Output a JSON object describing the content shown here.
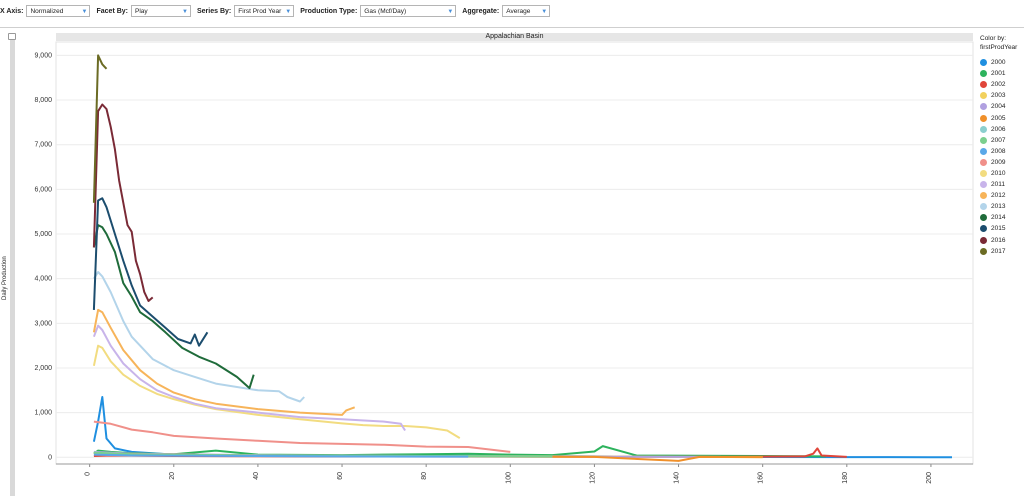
{
  "toolbar": {
    "x_axis": {
      "label": "X Axis:",
      "value": "Normalized"
    },
    "facet_by": {
      "label": "Facet By:",
      "value": "Play"
    },
    "series_by": {
      "label": "Series By:",
      "value": "First Prod Year"
    },
    "production_type": {
      "label": "Production Type:",
      "value": "Gas (Mcf/Day)"
    },
    "aggregate": {
      "label": "Aggregate:",
      "value": "Average"
    }
  },
  "legend": {
    "title": "Color by:",
    "field": "firstProdYear"
  },
  "chart_data": {
    "type": "line",
    "title": "Appalachian Basin",
    "xlabel": "",
    "ylabel": "Daily Production",
    "xlim": [
      -8,
      210
    ],
    "ylim": [
      -150,
      9300
    ],
    "x_ticks": [
      0,
      20,
      40,
      60,
      80,
      100,
      120,
      140,
      160,
      180,
      200
    ],
    "y_ticks": [
      0,
      1000,
      2000,
      3000,
      4000,
      5000,
      6000,
      7000,
      8000,
      9000
    ],
    "y_tick_labels": [
      "0",
      "1,000",
      "2,000",
      "3,000",
      "4,000",
      "5,000",
      "6,000",
      "7,000",
      "8,000",
      "9,000"
    ],
    "grid": "horizontal",
    "legend_position": "right",
    "series": [
      {
        "name": "2000",
        "color": "#1f8fe0",
        "points": [
          [
            1,
            350
          ],
          [
            2,
            800
          ],
          [
            3,
            1350
          ],
          [
            4,
            420
          ],
          [
            6,
            200
          ],
          [
            10,
            120
          ],
          [
            20,
            60
          ],
          [
            40,
            30
          ],
          [
            60,
            20
          ],
          [
            80,
            40
          ],
          [
            100,
            30
          ],
          [
            120,
            20
          ],
          [
            150,
            10
          ],
          [
            180,
            5
          ],
          [
            185,
            5
          ],
          [
            200,
            0
          ],
          [
            205,
            0
          ]
        ]
      },
      {
        "name": "2001",
        "color": "#2db35d",
        "points": [
          [
            1,
            80
          ],
          [
            2,
            150
          ],
          [
            5,
            120
          ],
          [
            10,
            90
          ],
          [
            20,
            70
          ],
          [
            30,
            150
          ],
          [
            40,
            60
          ],
          [
            60,
            50
          ],
          [
            80,
            70
          ],
          [
            90,
            80
          ],
          [
            100,
            60
          ],
          [
            110,
            50
          ],
          [
            120,
            130
          ],
          [
            122,
            250
          ],
          [
            130,
            40
          ],
          [
            160,
            30
          ],
          [
            175,
            20
          ]
        ]
      },
      {
        "name": "2002",
        "color": "#e0463a",
        "points": [
          [
            1,
            30
          ],
          [
            5,
            40
          ],
          [
            20,
            30
          ],
          [
            60,
            20
          ],
          [
            100,
            15
          ],
          [
            150,
            10
          ],
          [
            170,
            20
          ],
          [
            172,
            80
          ],
          [
            173,
            200
          ],
          [
            174,
            40
          ],
          [
            180,
            10
          ]
        ]
      },
      {
        "name": "2003",
        "color": "#f2d15e",
        "points": [
          [
            1,
            100
          ],
          [
            10,
            80
          ],
          [
            40,
            40
          ],
          [
            80,
            30
          ],
          [
            120,
            20
          ],
          [
            140,
            10
          ],
          [
            160,
            5
          ]
        ]
      },
      {
        "name": "2004",
        "color": "#b0a0e0",
        "points": [
          [
            1,
            120
          ],
          [
            10,
            80
          ],
          [
            40,
            50
          ],
          [
            80,
            30
          ],
          [
            120,
            15
          ],
          [
            150,
            10
          ]
        ]
      },
      {
        "name": "2005",
        "color": "#f0902a",
        "points": [
          [
            1,
            90
          ],
          [
            10,
            70
          ],
          [
            40,
            40
          ],
          [
            80,
            20
          ],
          [
            120,
            10
          ],
          [
            140,
            -80
          ],
          [
            145,
            10
          ],
          [
            160,
            5
          ]
        ]
      },
      {
        "name": "2006",
        "color": "#8ccfce",
        "points": [
          [
            1,
            110
          ],
          [
            10,
            60
          ],
          [
            40,
            40
          ],
          [
            80,
            25
          ],
          [
            110,
            15
          ]
        ]
      },
      {
        "name": "2007",
        "color": "#7ccf8e",
        "points": [
          [
            1,
            100
          ],
          [
            10,
            70
          ],
          [
            40,
            40
          ],
          [
            80,
            30
          ],
          [
            110,
            20
          ]
        ]
      },
      {
        "name": "2008",
        "color": "#5aa8e8",
        "points": [
          [
            1,
            60
          ],
          [
            10,
            40
          ],
          [
            40,
            30
          ],
          [
            60,
            20
          ],
          [
            90,
            15
          ]
        ]
      },
      {
        "name": "2009",
        "color": "#f0908a",
        "points": [
          [
            1,
            800
          ],
          [
            5,
            750
          ],
          [
            10,
            620
          ],
          [
            15,
            560
          ],
          [
            20,
            480
          ],
          [
            30,
            420
          ],
          [
            40,
            370
          ],
          [
            50,
            320
          ],
          [
            60,
            300
          ],
          [
            70,
            280
          ],
          [
            80,
            240
          ],
          [
            90,
            230
          ],
          [
            100,
            120
          ]
        ]
      },
      {
        "name": "2010",
        "color": "#f2dc80",
        "points": [
          [
            1,
            2050
          ],
          [
            2,
            2500
          ],
          [
            3,
            2450
          ],
          [
            5,
            2150
          ],
          [
            8,
            1850
          ],
          [
            12,
            1600
          ],
          [
            16,
            1420
          ],
          [
            20,
            1300
          ],
          [
            25,
            1180
          ],
          [
            30,
            1080
          ],
          [
            40,
            950
          ],
          [
            50,
            850
          ],
          [
            60,
            760
          ],
          [
            65,
            720
          ],
          [
            70,
            700
          ],
          [
            75,
            700
          ],
          [
            80,
            670
          ],
          [
            85,
            600
          ],
          [
            88,
            430
          ]
        ]
      },
      {
        "name": "2011",
        "color": "#c8b4ea",
        "points": [
          [
            1,
            2700
          ],
          [
            2,
            2950
          ],
          [
            3,
            2850
          ],
          [
            5,
            2500
          ],
          [
            8,
            2100
          ],
          [
            12,
            1750
          ],
          [
            16,
            1500
          ],
          [
            20,
            1350
          ],
          [
            25,
            1200
          ],
          [
            30,
            1100
          ],
          [
            40,
            1000
          ],
          [
            50,
            900
          ],
          [
            60,
            850
          ],
          [
            70,
            800
          ],
          [
            74,
            750
          ],
          [
            75,
            600
          ]
        ]
      },
      {
        "name": "2012",
        "color": "#f7b45a",
        "points": [
          [
            1,
            2800
          ],
          [
            2,
            3300
          ],
          [
            3,
            3250
          ],
          [
            5,
            2900
          ],
          [
            8,
            2400
          ],
          [
            12,
            1950
          ],
          [
            16,
            1650
          ],
          [
            20,
            1450
          ],
          [
            25,
            1300
          ],
          [
            30,
            1200
          ],
          [
            40,
            1080
          ],
          [
            50,
            1000
          ],
          [
            60,
            950
          ],
          [
            61,
            1050
          ],
          [
            63,
            1120
          ]
        ]
      },
      {
        "name": "2013",
        "color": "#b3d4ea",
        "points": [
          [
            1,
            4000
          ],
          [
            2,
            4150
          ],
          [
            3,
            4050
          ],
          [
            5,
            3700
          ],
          [
            8,
            3050
          ],
          [
            10,
            2700
          ],
          [
            15,
            2200
          ],
          [
            20,
            1950
          ],
          [
            25,
            1800
          ],
          [
            30,
            1650
          ],
          [
            40,
            1500
          ],
          [
            45,
            1480
          ],
          [
            47,
            1350
          ],
          [
            50,
            1250
          ],
          [
            51,
            1350
          ]
        ]
      },
      {
        "name": "2014",
        "color": "#1f6b3a",
        "points": [
          [
            1,
            4700
          ],
          [
            2,
            5200
          ],
          [
            3,
            5150
          ],
          [
            4,
            5000
          ],
          [
            6,
            4600
          ],
          [
            8,
            3900
          ],
          [
            10,
            3600
          ],
          [
            12,
            3250
          ],
          [
            15,
            3050
          ],
          [
            18,
            2800
          ],
          [
            22,
            2450
          ],
          [
            26,
            2250
          ],
          [
            30,
            2100
          ],
          [
            35,
            1800
          ],
          [
            38,
            1550
          ],
          [
            39,
            1850
          ]
        ]
      },
      {
        "name": "2015",
        "color": "#1c4d6e",
        "points": [
          [
            1,
            3300
          ],
          [
            2,
            5750
          ],
          [
            3,
            5800
          ],
          [
            4,
            5600
          ],
          [
            6,
            5000
          ],
          [
            8,
            4400
          ],
          [
            10,
            3850
          ],
          [
            12,
            3400
          ],
          [
            15,
            3150
          ],
          [
            18,
            2900
          ],
          [
            21,
            2650
          ],
          [
            24,
            2550
          ],
          [
            25,
            2750
          ],
          [
            26,
            2500
          ],
          [
            28,
            2800
          ]
        ]
      },
      {
        "name": "2016",
        "color": "#7a2a36",
        "points": [
          [
            1,
            4700
          ],
          [
            2,
            7750
          ],
          [
            3,
            7900
          ],
          [
            4,
            7800
          ],
          [
            5,
            7400
          ],
          [
            6,
            6900
          ],
          [
            7,
            6200
          ],
          [
            9,
            5200
          ],
          [
            10,
            5050
          ],
          [
            11,
            4400
          ],
          [
            12,
            4100
          ],
          [
            13,
            3700
          ],
          [
            14,
            3500
          ],
          [
            15,
            3580
          ]
        ]
      },
      {
        "name": "2017",
        "color": "#6b6b24",
        "points": [
          [
            1,
            5700
          ],
          [
            2,
            9000
          ],
          [
            3,
            8800
          ],
          [
            4,
            8700
          ]
        ]
      }
    ]
  }
}
